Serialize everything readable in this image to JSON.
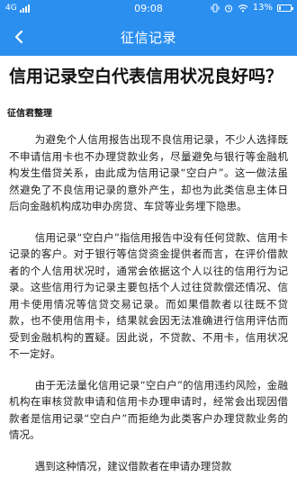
{
  "status_bar": {
    "network": "4G",
    "time": "09:08",
    "battery": "13%",
    "battery_level": 0.13
  },
  "nav": {
    "title": "征信记录",
    "back_icon": "chevron-left-icon"
  },
  "article": {
    "title": "信用记录空白代表信用状况良好吗？",
    "author": "征信君整理",
    "paragraphs": [
      "为避免个人信用报告出现不良信用记录，不少人选择既不申请信用卡也不办理贷款业务，尽量避免与银行等金融机构发生借贷关系，由此成为信用记录“空白户”。这一做法虽然避免了不良信用记录的意外产生，却也为此类信息主体日后向金融机构成功申办房贷、车贷等业务埋下隐患。",
      "信用记录“空白户”指信用报告中没有任何贷款、信用卡记录的客户。对于银行等信贷资金提供者而言，在评价借款者的个人信用状况时，通常会依据这个人以往的信用行为记录。这些信用行为记录主要包括个人过往贷款偿还情况、信用卡使用情况等信贷交易记录。而如果借款者以往既不贷款，也不使用信用卡，结果就会因无法准确进行信用评估而受到金融机构的置疑。因此说，不贷款、不用卡，信用状况不一定好。",
      "由于无法量化信用记录“空白户”的信用违约风险，金融机构在审核贷款申请和信用卡办理申请时，经常会出现因借款者是信用记录“空白户”而拒绝为此类客户办理贷款业务的情况。",
      "遇到这种情况，建议借款者在申请办理贷款"
    ]
  }
}
